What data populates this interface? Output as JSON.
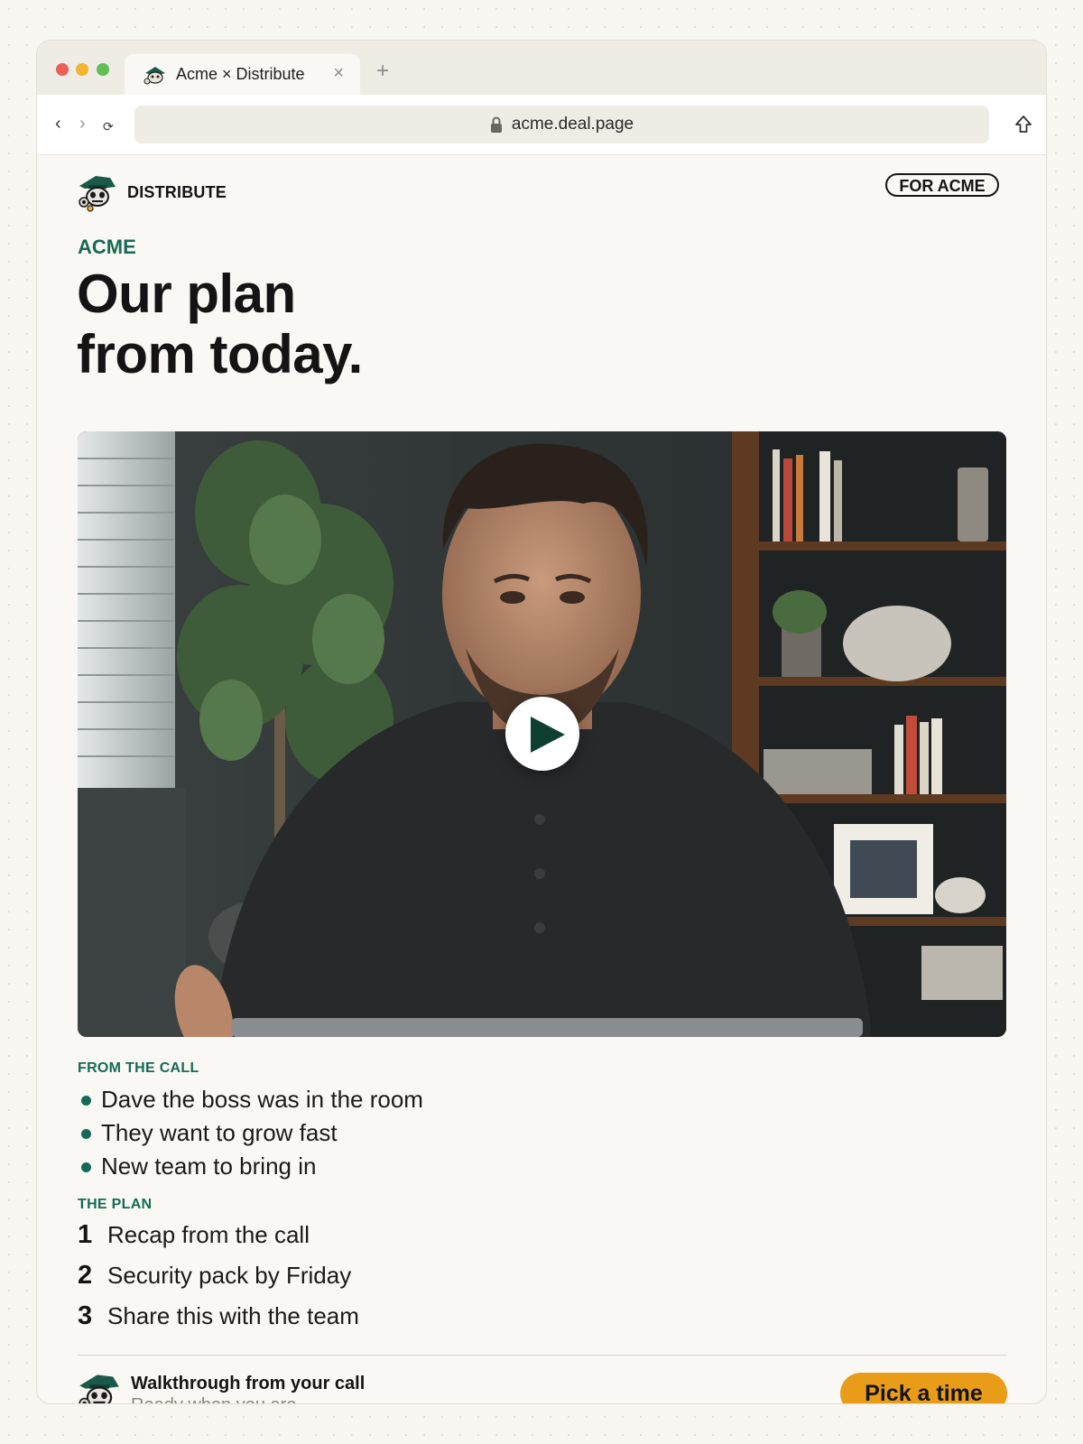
{
  "browser": {
    "tab_title": "Acme × Distribute",
    "tab_close": "×",
    "new_tab": "+",
    "url": "acme.deal.page",
    "nav_back": "‹",
    "nav_forward": "›",
    "nav_reload": "⟳"
  },
  "header": {
    "brand_name": "DISTRIBUTE",
    "audience_badge": "FOR ACME"
  },
  "hero": {
    "eyebrow": "ACME",
    "headline_line1": "Our plan",
    "headline_line2": "from today."
  },
  "video": {
    "state": "paused",
    "play_icon": "play-icon"
  },
  "from_the_call": {
    "label": "FROM THE CALL",
    "items": [
      "Dave the boss was in the room",
      "They want to grow fast",
      "New team to bring in"
    ]
  },
  "the_plan": {
    "label": "THE PLAN",
    "steps": [
      {
        "num": "1",
        "text": "Recap from the call"
      },
      {
        "num": "2",
        "text": "Security pack by Friday"
      },
      {
        "num": "3",
        "text": "Share this with the team"
      }
    ]
  },
  "footer": {
    "title": "Walkthrough from your call",
    "subtitle": "Ready when you are.",
    "cta_label": "Pick a time"
  },
  "colors": {
    "accent_green": "#156a55",
    "cta_orange": "#e89c17",
    "page_bg": "#f8f6f1"
  }
}
